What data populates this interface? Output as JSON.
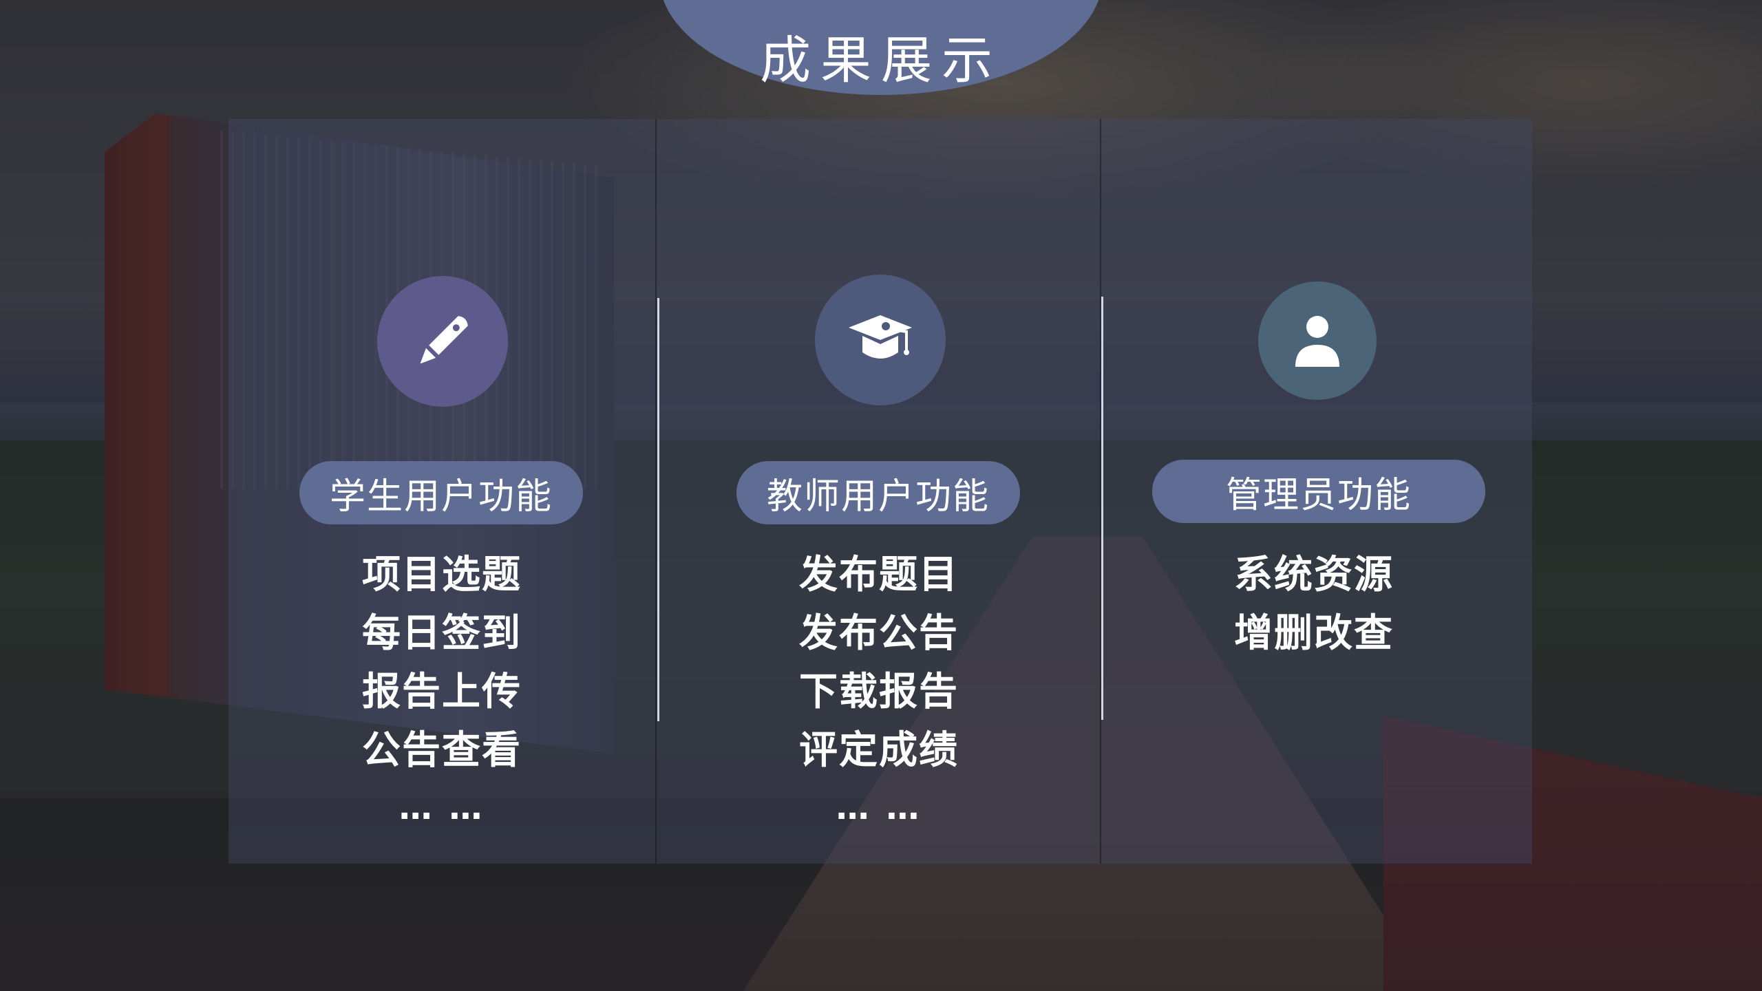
{
  "header": {
    "title": "成果展示"
  },
  "columns": [
    {
      "title": "学生用户功能",
      "icon": "pencil-icon",
      "icon_color": "#5e5a8c",
      "items": [
        "项目选题",
        "每日签到",
        "报告上传",
        "公告查看"
      ],
      "more": "… …"
    },
    {
      "title": "教师用户功能",
      "icon": "graduation-cap-icon",
      "icon_color": "#4d5a7c",
      "items": [
        "发布题目",
        "发布公告",
        "下载报告",
        "评定成绩"
      ],
      "more": "… …"
    },
    {
      "title": "管理员功能",
      "icon": "user-icon",
      "icon_color": "#4c6478",
      "items": [
        "系统资源",
        "增删改查"
      ]
    }
  ],
  "colors": {
    "accent_pill": "#5f6d95",
    "text": "#ffffff"
  }
}
